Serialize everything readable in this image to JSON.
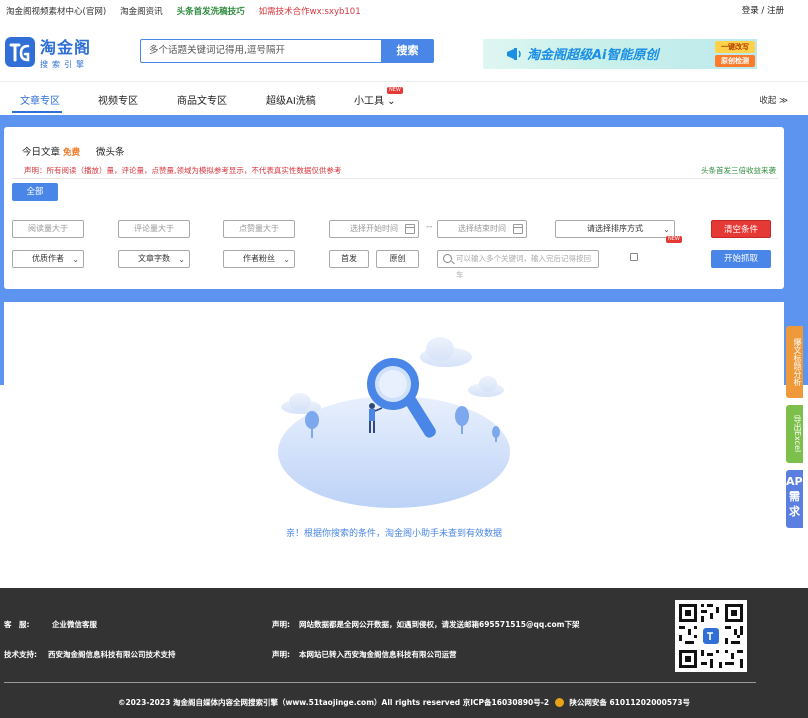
{
  "topbar": {
    "link1": "淘金阁视频素材中心(官网)",
    "link2": "淘金阁资讯",
    "link3": "头条首发洗稿技巧",
    "link4": "如需技术合作wx:sxyb101",
    "login": "登录 / 注册"
  },
  "logo": {
    "title": "淘金阁",
    "subtitle": "搜索引擎"
  },
  "search": {
    "placeholder": "多个话题关键词记得用,逗号隔开",
    "button": "搜索"
  },
  "banner": {
    "text": "淘金阁超级Ai智能原创",
    "badge1": "一键改写",
    "badge2": "原创检测"
  },
  "nav": {
    "items": [
      "文章专区",
      "视频专区",
      "商品文专区",
      "超级AI洗稿",
      "小工具"
    ],
    "new_tag": "NEW",
    "collapse": "收起 ≫"
  },
  "panel": {
    "tab_today": "今日文章",
    "free": "免费",
    "tab_weitoutiao": "微头条",
    "notice": "声明：所有阅读（播放）量，评论量，点赞量,领域为模拟参考显示，不代表真实性数据仅供参考",
    "notice_right": "头条首发三倍收益来袭",
    "all": "全部",
    "row1": {
      "read": "阅读量大于",
      "comment": "评论量大于",
      "like": "点赞量大于",
      "start_time": "选择开始时间",
      "dash": "--",
      "end_time": "选择结束时间",
      "sort": "请选择排序方式",
      "clear": "清空条件"
    },
    "row2": {
      "author": "优质作者",
      "wordcount": "文章字数",
      "fans": "作者粉丝",
      "first": "首发",
      "original": "原创",
      "keyword_placeholder": "可以输入多个关键词，输入完后记得按回车",
      "fetch": "开始抓取"
    }
  },
  "results": {
    "empty": "亲！根据你搜索的条件，淘金阁小助手未查到有效数据"
  },
  "side": {
    "analysis": "爆文标题分析",
    "excel": "导出Excel",
    "api": "API需求"
  },
  "footer": {
    "cs_label": "客　服:",
    "cs_value": "企业微信客服",
    "tech_label": "技术支持:",
    "tech_value": "西安淘金阁信息科技有限公司技术支持",
    "decl1_label": "声明:",
    "decl1": "网站数据都是全网公开数据，如遇到侵权，请发送邮箱695571515@qq.com下架",
    "decl2_label": "声明:",
    "decl2": "本网站已转入西安淘金阁信息科技有限公司运营",
    "copyright": "©2023-2023 淘金阁自媒体内容全网搜索引擎（www.51taojinge.com）All rights reserved 京ICP备16030890号-2",
    "police": "陕公网安备 61011202000573号"
  },
  "colors": {
    "primary": "#4a86e8",
    "band": "#5c94f0",
    "danger": "#e53935",
    "footer": "#333333"
  }
}
